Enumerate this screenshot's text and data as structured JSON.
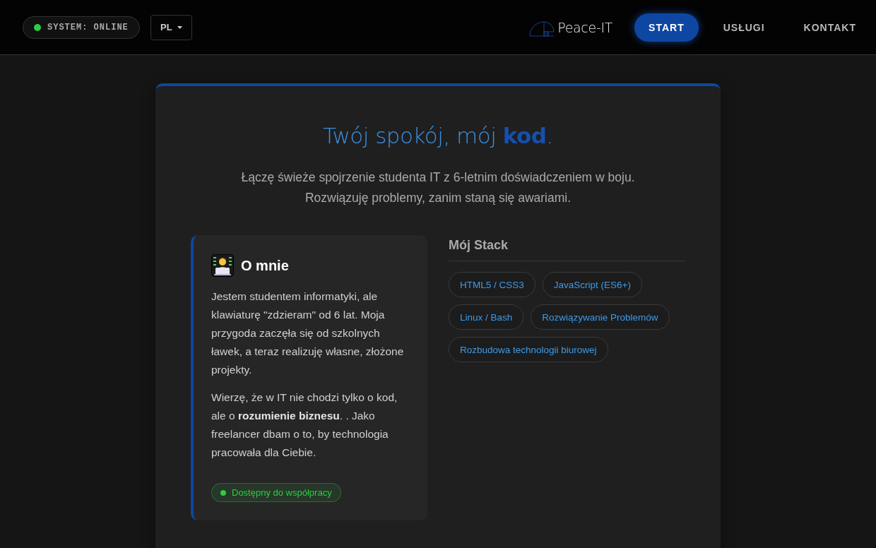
{
  "header": {
    "status": {
      "label": "SYSTEM: ONLINE",
      "online": true
    },
    "language": {
      "value": "PL"
    },
    "logo": {
      "text": "Peace-IT"
    },
    "nav": [
      {
        "label": "START",
        "selected": true
      },
      {
        "label": "USŁUGI",
        "selected": false
      },
      {
        "label": "KONTAKT",
        "selected": false
      }
    ]
  },
  "hero": {
    "title": "Twój spokój, mój **kod**.",
    "subtitle": [
      "Łączę świeże spojrzenie studenta IT z 6-letnim doświadczeniem w boju.",
      "Rozwiązuję problemy, zanim staną się awariami."
    ]
  },
  "about": {
    "title": "O mnie",
    "paragraphs": [
      "Jestem studentem informatyki, ale klawiaturę \"zdzieram\" od 6 lat. Moja przygoda zaczęła się od szkolnych ławek, a teraz realizuję własne, złożone projekty.",
      "Wierzę, że w IT nie chodzi tylko o kod, ale o **rozumienie biznesu**. . Jako freelancer dbam o to, by technologia pracowała dla Ciebie."
    ],
    "availability": {
      "label": "Dostępny do współpracy",
      "available": true
    }
  },
  "stack": {
    "title": "Mój Stack",
    "tags": [
      "HTML5 / CSS3",
      "JavaScript (ES6+)",
      "Linux / Bash",
      "Rozwiązywanie Problemów",
      "Rozbudowa technologii biurowej"
    ]
  }
}
